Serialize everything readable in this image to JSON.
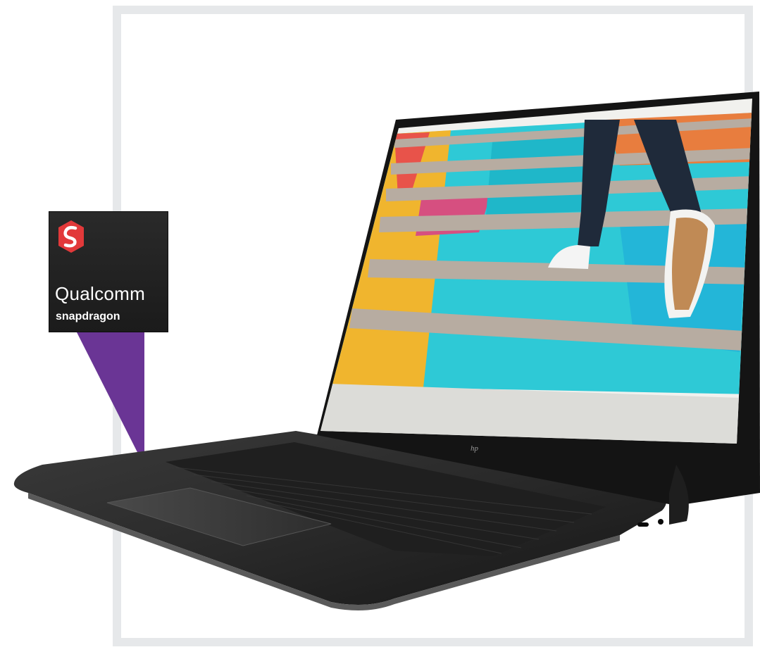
{
  "badge": {
    "brand": "Qualcomm",
    "sub": "snapdragon",
    "accent_color": "#e2393a",
    "pointer_color": "#6a3595"
  },
  "product": {
    "screen_image": "colorful-stairs-running-person",
    "logo_icon": "hp-logo-icon"
  }
}
